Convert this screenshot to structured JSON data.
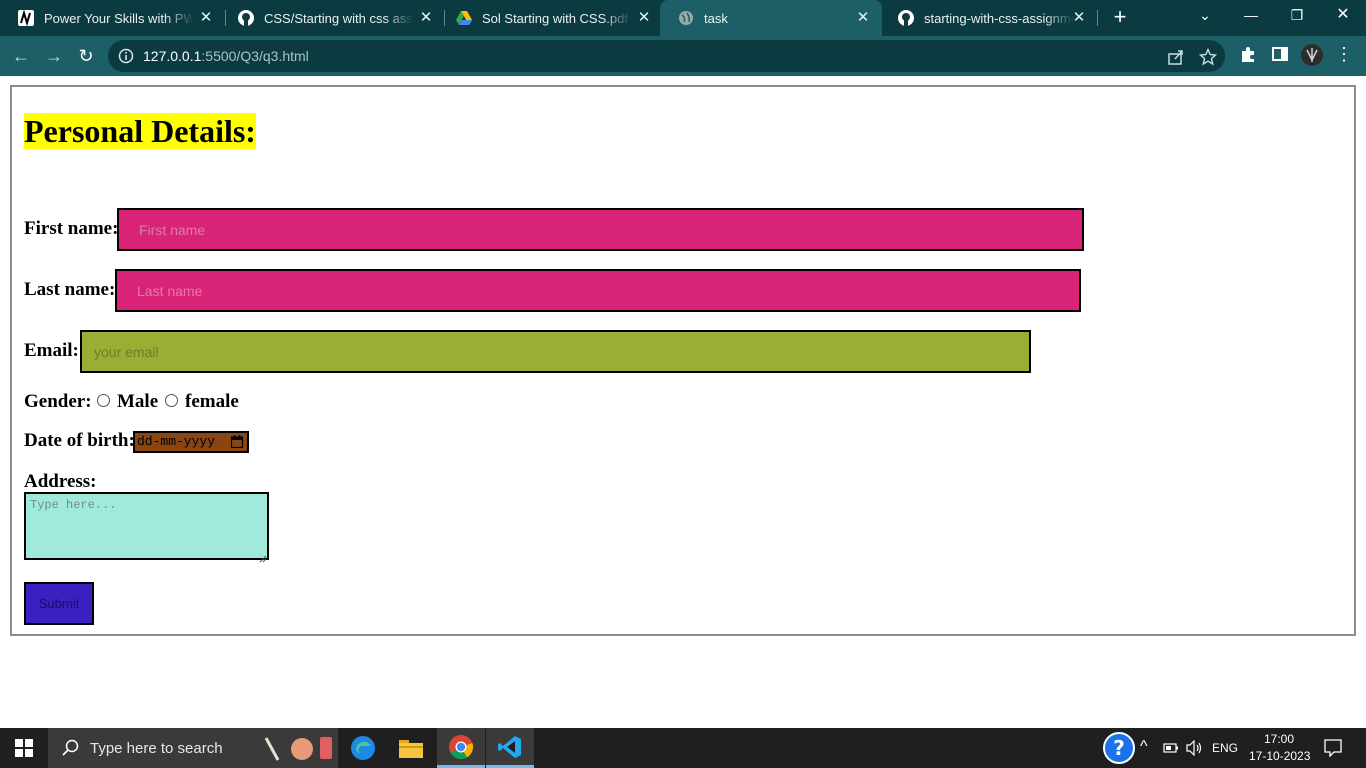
{
  "browser": {
    "tabs": [
      {
        "title": "Power Your Skills with PW Sk",
        "active": false
      },
      {
        "title": "CSS/Starting with css assignm",
        "active": false
      },
      {
        "title": "Sol Starting with CSS.pdf - G",
        "active": false
      },
      {
        "title": "task",
        "active": true
      },
      {
        "title": "starting-with-css-assignmen",
        "active": false
      }
    ],
    "new_tab_label": "+",
    "url_host": "127.0.0.1",
    "url_rest": ":5500/Q3/q3.html"
  },
  "page": {
    "heading": "Personal Details:",
    "first_name": {
      "label": "First name:",
      "placeholder": "First name"
    },
    "last_name": {
      "label": "Last name:",
      "placeholder": "Last name"
    },
    "email": {
      "label": "Email:",
      "placeholder": "your email"
    },
    "gender": {
      "label": "Gender:",
      "options": [
        "Male",
        "female"
      ]
    },
    "dob": {
      "label": "Date of birth:",
      "placeholder": "dd-mm-yyyy"
    },
    "address": {
      "label": "Address:",
      "placeholder": "Type here..."
    },
    "submit_label": "Submit",
    "colors": {
      "heading_bg": "#ffff00",
      "name_fields": "#d92377",
      "email_field": "#9aad34",
      "dob_field": "#8b4513",
      "address_field": "#a0eadb",
      "submit_button": "#3b1fbf"
    }
  },
  "taskbar": {
    "search_placeholder": "Type here to search",
    "language": "ENG",
    "time": "17:00",
    "date": "17-10-2023"
  }
}
